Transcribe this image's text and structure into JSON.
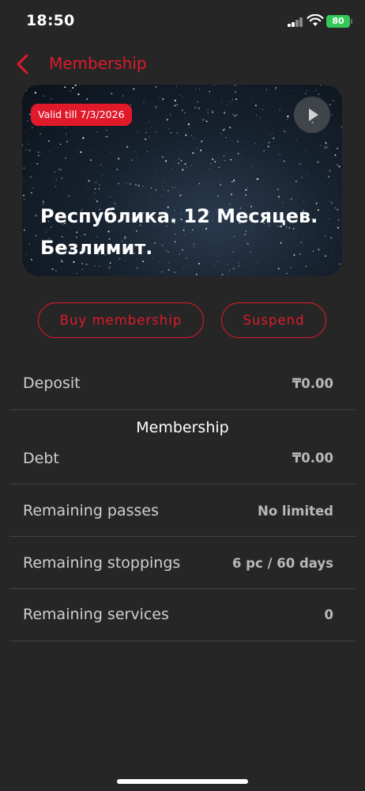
{
  "status_bar": {
    "time": "18:50",
    "battery": "80",
    "icons": [
      "cellular-signal-icon",
      "wifi-icon",
      "battery-icon"
    ]
  },
  "header": {
    "back_icon": "chevron-left-icon",
    "title": "Membership"
  },
  "card": {
    "badge": "Valid till 7/3/2026",
    "play_icon": "play-icon",
    "title_line1": "Республика. 12 Месяцев.",
    "title_line2": "Безлимит."
  },
  "actions": {
    "buy_label": "Buy membership",
    "suspend_label": "Suspend"
  },
  "deposit": {
    "label": "Deposit",
    "value": "₸0.00"
  },
  "section": {
    "title": "Membership"
  },
  "details": [
    {
      "label": "Debt",
      "value": "₸0.00"
    },
    {
      "label": "Remaining passes",
      "value": "No limited"
    },
    {
      "label": "Remaining stoppings",
      "value": "6 pc / 60 days"
    },
    {
      "label": "Remaining services",
      "value": "0"
    }
  ],
  "colors": {
    "accent": "#e01a2b",
    "background": "#262626",
    "battery": "#34c759"
  }
}
